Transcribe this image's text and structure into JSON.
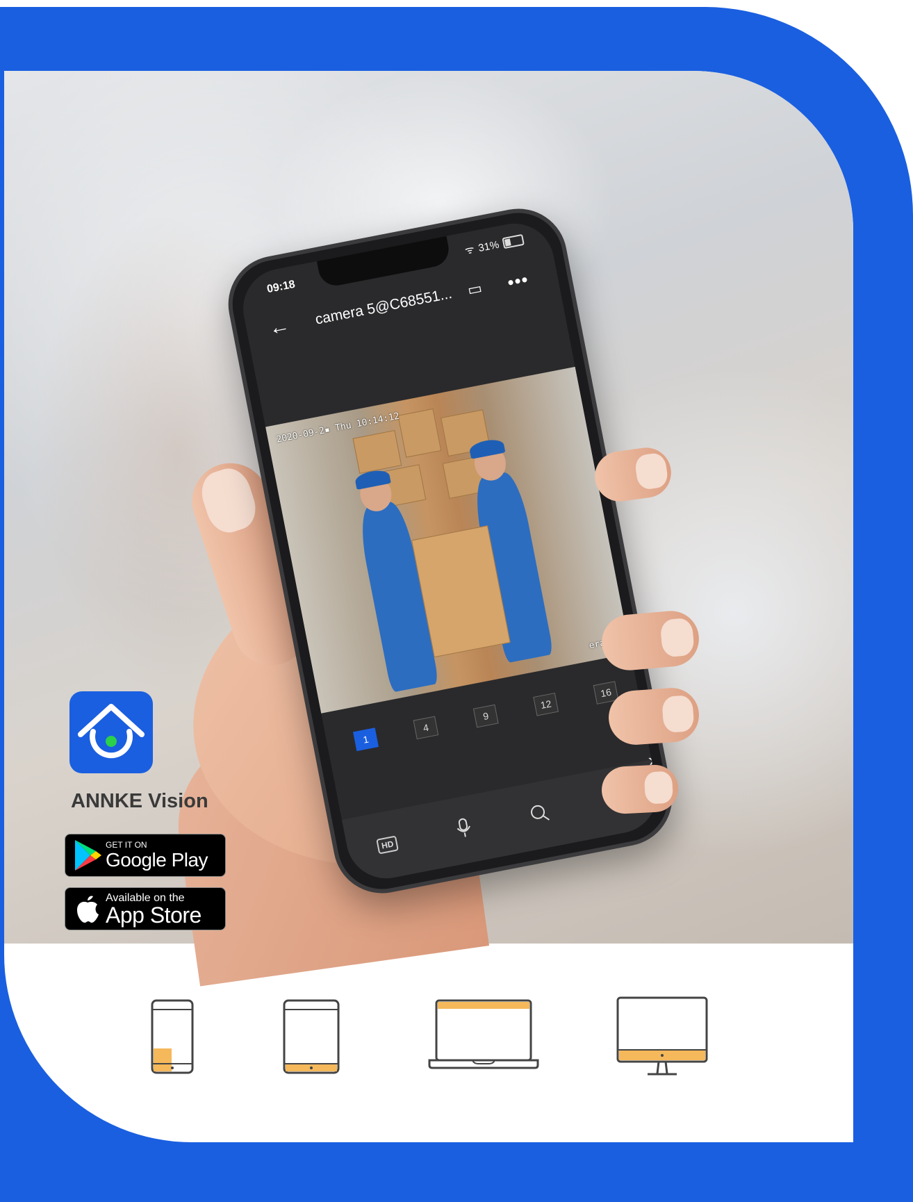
{
  "app": {
    "name": "ANNKE Vision"
  },
  "phone_ui": {
    "status_time": "09:18",
    "battery_text": "31%",
    "camera_title": "camera 5@C68551...",
    "osd_timestamp": "2020-09-2▪ Thu 10:14:12",
    "osd_camera": "era 01",
    "split_options": [
      "1",
      "4",
      "9",
      "12",
      "16"
    ],
    "split_selected": "1",
    "hd_label": "HD"
  },
  "stores": {
    "google_small": "GET IT ON",
    "google_big": "Google Play",
    "apple_small": "Available on the",
    "apple_big": "App Store"
  },
  "devices": [
    "phone-icon",
    "tablet-icon",
    "laptop-icon",
    "desktop-icon"
  ],
  "colors": {
    "brand_blue": "#1a5fe0",
    "device_accent": "#f5b85a",
    "device_stroke": "#444444"
  }
}
